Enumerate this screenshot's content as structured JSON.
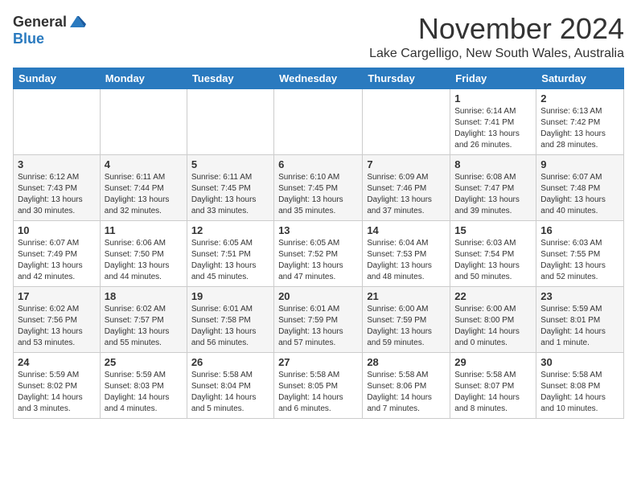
{
  "logo": {
    "general": "General",
    "blue": "Blue"
  },
  "title": {
    "month": "November 2024",
    "location": "Lake Cargelligo, New South Wales, Australia"
  },
  "headers": [
    "Sunday",
    "Monday",
    "Tuesday",
    "Wednesday",
    "Thursday",
    "Friday",
    "Saturday"
  ],
  "weeks": [
    [
      {
        "day": "",
        "info": ""
      },
      {
        "day": "",
        "info": ""
      },
      {
        "day": "",
        "info": ""
      },
      {
        "day": "",
        "info": ""
      },
      {
        "day": "",
        "info": ""
      },
      {
        "day": "1",
        "info": "Sunrise: 6:14 AM\nSunset: 7:41 PM\nDaylight: 13 hours\nand 26 minutes."
      },
      {
        "day": "2",
        "info": "Sunrise: 6:13 AM\nSunset: 7:42 PM\nDaylight: 13 hours\nand 28 minutes."
      }
    ],
    [
      {
        "day": "3",
        "info": "Sunrise: 6:12 AM\nSunset: 7:43 PM\nDaylight: 13 hours\nand 30 minutes."
      },
      {
        "day": "4",
        "info": "Sunrise: 6:11 AM\nSunset: 7:44 PM\nDaylight: 13 hours\nand 32 minutes."
      },
      {
        "day": "5",
        "info": "Sunrise: 6:11 AM\nSunset: 7:45 PM\nDaylight: 13 hours\nand 33 minutes."
      },
      {
        "day": "6",
        "info": "Sunrise: 6:10 AM\nSunset: 7:45 PM\nDaylight: 13 hours\nand 35 minutes."
      },
      {
        "day": "7",
        "info": "Sunrise: 6:09 AM\nSunset: 7:46 PM\nDaylight: 13 hours\nand 37 minutes."
      },
      {
        "day": "8",
        "info": "Sunrise: 6:08 AM\nSunset: 7:47 PM\nDaylight: 13 hours\nand 39 minutes."
      },
      {
        "day": "9",
        "info": "Sunrise: 6:07 AM\nSunset: 7:48 PM\nDaylight: 13 hours\nand 40 minutes."
      }
    ],
    [
      {
        "day": "10",
        "info": "Sunrise: 6:07 AM\nSunset: 7:49 PM\nDaylight: 13 hours\nand 42 minutes."
      },
      {
        "day": "11",
        "info": "Sunrise: 6:06 AM\nSunset: 7:50 PM\nDaylight: 13 hours\nand 44 minutes."
      },
      {
        "day": "12",
        "info": "Sunrise: 6:05 AM\nSunset: 7:51 PM\nDaylight: 13 hours\nand 45 minutes."
      },
      {
        "day": "13",
        "info": "Sunrise: 6:05 AM\nSunset: 7:52 PM\nDaylight: 13 hours\nand 47 minutes."
      },
      {
        "day": "14",
        "info": "Sunrise: 6:04 AM\nSunset: 7:53 PM\nDaylight: 13 hours\nand 48 minutes."
      },
      {
        "day": "15",
        "info": "Sunrise: 6:03 AM\nSunset: 7:54 PM\nDaylight: 13 hours\nand 50 minutes."
      },
      {
        "day": "16",
        "info": "Sunrise: 6:03 AM\nSunset: 7:55 PM\nDaylight: 13 hours\nand 52 minutes."
      }
    ],
    [
      {
        "day": "17",
        "info": "Sunrise: 6:02 AM\nSunset: 7:56 PM\nDaylight: 13 hours\nand 53 minutes."
      },
      {
        "day": "18",
        "info": "Sunrise: 6:02 AM\nSunset: 7:57 PM\nDaylight: 13 hours\nand 55 minutes."
      },
      {
        "day": "19",
        "info": "Sunrise: 6:01 AM\nSunset: 7:58 PM\nDaylight: 13 hours\nand 56 minutes."
      },
      {
        "day": "20",
        "info": "Sunrise: 6:01 AM\nSunset: 7:59 PM\nDaylight: 13 hours\nand 57 minutes."
      },
      {
        "day": "21",
        "info": "Sunrise: 6:00 AM\nSunset: 7:59 PM\nDaylight: 13 hours\nand 59 minutes."
      },
      {
        "day": "22",
        "info": "Sunrise: 6:00 AM\nSunset: 8:00 PM\nDaylight: 14 hours\nand 0 minutes."
      },
      {
        "day": "23",
        "info": "Sunrise: 5:59 AM\nSunset: 8:01 PM\nDaylight: 14 hours\nand 1 minute."
      }
    ],
    [
      {
        "day": "24",
        "info": "Sunrise: 5:59 AM\nSunset: 8:02 PM\nDaylight: 14 hours\nand 3 minutes."
      },
      {
        "day": "25",
        "info": "Sunrise: 5:59 AM\nSunset: 8:03 PM\nDaylight: 14 hours\nand 4 minutes."
      },
      {
        "day": "26",
        "info": "Sunrise: 5:58 AM\nSunset: 8:04 PM\nDaylight: 14 hours\nand 5 minutes."
      },
      {
        "day": "27",
        "info": "Sunrise: 5:58 AM\nSunset: 8:05 PM\nDaylight: 14 hours\nand 6 minutes."
      },
      {
        "day": "28",
        "info": "Sunrise: 5:58 AM\nSunset: 8:06 PM\nDaylight: 14 hours\nand 7 minutes."
      },
      {
        "day": "29",
        "info": "Sunrise: 5:58 AM\nSunset: 8:07 PM\nDaylight: 14 hours\nand 8 minutes."
      },
      {
        "day": "30",
        "info": "Sunrise: 5:58 AM\nSunset: 8:08 PM\nDaylight: 14 hours\nand 10 minutes."
      }
    ]
  ]
}
